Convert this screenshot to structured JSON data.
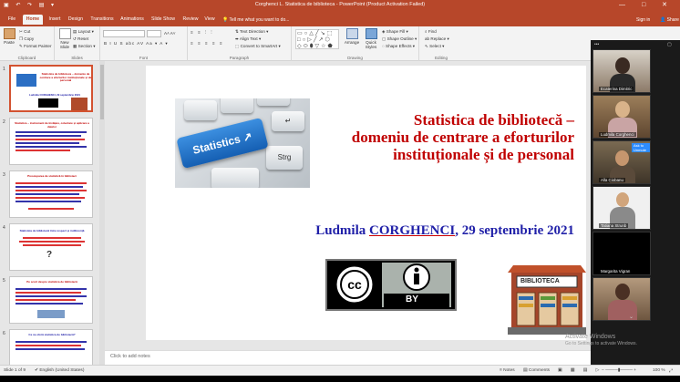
{
  "window": {
    "title": "Corghenci L. Statistica de biblioteca - PowerPoint (Product Activation Failed)",
    "qat_icons": "▣ ↶ ↷ ▤ ▾",
    "controls": "— □ ✕"
  },
  "tabs": [
    "File",
    "Home",
    "Insert",
    "Design",
    "Transitions",
    "Animations",
    "Slide Show",
    "Review",
    "View"
  ],
  "tell_me": "💡 Tell me what you want to do...",
  "sign_in": "Sign in",
  "share": "👤 Share",
  "ribbon": {
    "clipboard": {
      "label": "Clipboard",
      "paste": "Paste",
      "cut": "✂ Cut",
      "copy": "❐ Copy",
      "format_painter": "✎ Format Painter"
    },
    "slides": {
      "label": "Slides",
      "new_slide": "New Slide",
      "layout": "▤ Layout ▾",
      "reset": "↺ Reset",
      "section": "▦ Section ▾"
    },
    "font": {
      "label": "Font",
      "styles": "B  I  U  S  abc  AV  Aa ▾  A ▾",
      "size_arrows": "A˄ A˅"
    },
    "paragraph": {
      "label": "Paragraph",
      "row1": "≡ ≡ ⫶ ⫶",
      "text_direction": "⇅ Text Direction ▾",
      "align_text": "⬌ Align Text ▾",
      "smartart": "⬚ Convert to SmartArt ▾",
      "align_row": "≡ ≡ ≡ ≡ ≡"
    },
    "drawing": {
      "label": "Drawing",
      "shapes": "▭○△╱↘⬚ □○▷╱↗⬡ ◇⬭⬮▽☆⬟",
      "arrange": "Arrange",
      "quick_styles": "Quick Styles",
      "shape_fill": "◈ Shape Fill ▾",
      "shape_outline": "▢ Shape Outline ▾",
      "shape_effects": "◌ Shape Effects ▾"
    },
    "editing": {
      "label": "Editing",
      "find": "⌕ Find",
      "replace": "ab Replace ▾",
      "select": "⇖ Select ▾"
    }
  },
  "thumbnails": [
    {
      "num": "1",
      "title": "Statistica de biblioteca – domeniu de centrare a eforturilor instituționale și de personal",
      "author": "Ludmila CORGHENCI, 29 septembrie 2021"
    },
    {
      "num": "2",
      "title": "Statistica – instrument de învățare, colectare și aplicare a datelor"
    },
    {
      "num": "3",
      "title": "Preocuparea de statistică în biblioteci"
    },
    {
      "num": "4",
      "title": "Statistica de bibliotecă între respect și indiferență"
    },
    {
      "num": "5",
      "title": "Pe scurt despre statistica de bibliotecă"
    },
    {
      "num": "6",
      "title": "Ce ne oferă statistica de bibliotecă?"
    }
  ],
  "slide": {
    "title_line1": "Statistica de bibliotecă –",
    "title_line2": "domeniu de centrare a eforturilor",
    "title_line3": "instituționale și de personal",
    "author_name": "Ludmila ",
    "author_surname": "CORGHENCI",
    "author_date": ", 29 septembrie 2021",
    "keyboard_key": "Statistics",
    "keyboard_key2": "Strg",
    "cc_text": "BY",
    "library_sign": "BIBLIOTECA"
  },
  "notes_placeholder": "Click to add notes",
  "status": {
    "slide_of": "Slide 1 of 9",
    "language": "✔ English (United States)",
    "notes": "≡ Notes",
    "comments": "▤ Comments",
    "zoom": "100 %"
  },
  "activate": {
    "line1": "Activate Windows",
    "line2": "Go to Settings to activate Windows."
  },
  "zoom_participants": [
    {
      "name": "Ecaterina Dimitric"
    },
    {
      "name": "Ludmila Corghenci"
    },
    {
      "name": "Alla Ciobanu"
    },
    {
      "name": "Tatiana Strunb"
    },
    {
      "name": "Margarita Vigran"
    },
    {
      "name": ""
    }
  ],
  "zoom_badge": "Ask to Unmute"
}
